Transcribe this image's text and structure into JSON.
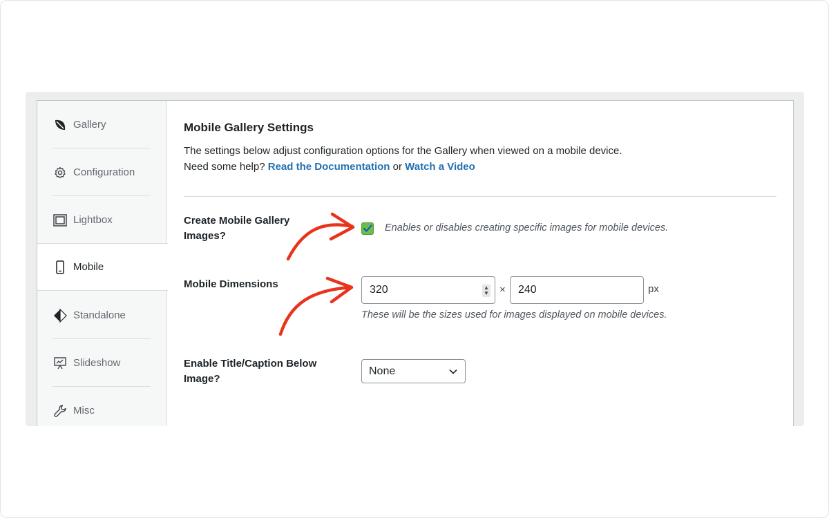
{
  "sidebar": {
    "items": [
      {
        "label": "Gallery",
        "icon": "leaf-icon"
      },
      {
        "label": "Configuration",
        "icon": "gear-icon"
      },
      {
        "label": "Lightbox",
        "icon": "lightbox-icon"
      },
      {
        "label": "Mobile",
        "icon": "mobile-icon",
        "active": true
      },
      {
        "label": "Standalone",
        "icon": "diamond-icon"
      },
      {
        "label": "Slideshow",
        "icon": "slideshow-icon"
      },
      {
        "label": "Misc",
        "icon": "wrench-icon"
      }
    ]
  },
  "main": {
    "title": "Mobile Gallery Settings",
    "description_line1": "The settings below adjust configuration options for the Gallery when viewed on a mobile device.",
    "help_prefix": "Need some help?",
    "doc_link": "Read the Documentation",
    "or_text": "or",
    "video_link": "Watch a Video",
    "create_mobile": {
      "label": "Create Mobile Gallery Images?",
      "checked": true,
      "hint": "Enables or disables creating specific images for mobile devices."
    },
    "dimensions": {
      "label": "Mobile Dimensions",
      "width": "320",
      "height": "240",
      "times": "×",
      "unit": "px",
      "hint": "These will be the sizes used for images displayed on mobile devices."
    },
    "title_caption": {
      "label": "Enable Title/Caption Below Image?",
      "selected": "None"
    }
  },
  "colors": {
    "link": "#2271b1",
    "checkbox": "#6abf4b",
    "annotation_arrow": "#e8341c"
  }
}
